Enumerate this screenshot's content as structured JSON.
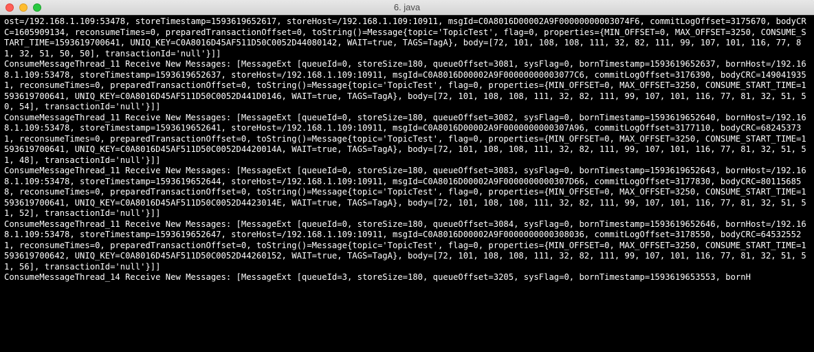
{
  "window": {
    "title": "6. java"
  },
  "log": {
    "lines": [
      "ost=/192.168.1.109:53478, storeTimestamp=1593619652617, storeHost=/192.168.1.109:10911, msgId=C0A8016D00002A9F00000000003074F6, commitLogOffset=3175670, bodyCRC=1605909134, reconsumeTimes=0, preparedTransactionOffset=0, toString()=Message{topic='TopicTest', flag=0, properties={MIN_OFFSET=0, MAX_OFFSET=3250, CONSUME_START_TIME=1593619700641, UNIQ_KEY=C0A8016D45AF511D50C0052D44080142, WAIT=true, TAGS=TagA}, body=[72, 101, 108, 108, 111, 32, 82, 111, 99, 107, 101, 116, 77, 81, 32, 51, 50, 50], transactionId='null'}]]",
      "ConsumeMessageThread_11 Receive New Messages: [MessageExt [queueId=0, storeSize=180, queueOffset=3081, sysFlag=0, bornTimestamp=1593619652637, bornHost=/192.168.1.109:53478, storeTimestamp=1593619652637, storeHost=/192.168.1.109:10911, msgId=C0A8016D00002A9F00000000003077C6, commitLogOffset=3176390, bodyCRC=1490419351, reconsumeTimes=0, preparedTransactionOffset=0, toString()=Message{topic='TopicTest', flag=0, properties={MIN_OFFSET=0, MAX_OFFSET=3250, CONSUME_START_TIME=1593619700641, UNIQ_KEY=C0A8016D45AF511D50C0052D441D0146, WAIT=true, TAGS=TagA}, body=[72, 101, 108, 108, 111, 32, 82, 111, 99, 107, 101, 116, 77, 81, 32, 51, 50, 54], transactionId='null'}]]",
      "ConsumeMessageThread_11 Receive New Messages: [MessageExt [queueId=0, storeSize=180, queueOffset=3082, sysFlag=0, bornTimestamp=1593619652640, bornHost=/192.168.1.109:53478, storeTimestamp=1593619652641, storeHost=/192.168.1.109:10911, msgId=C0A8016D00002A9F0000000000307A96, commitLogOffset=3177110, bodyCRC=682453731, reconsumeTimes=0, preparedTransactionOffset=0, toString()=Message{topic='TopicTest', flag=0, properties={MIN_OFFSET=0, MAX_OFFSET=3250, CONSUME_START_TIME=1593619700641, UNIQ_KEY=C0A8016D45AF511D50C0052D4420014A, WAIT=true, TAGS=TagA}, body=[72, 101, 108, 108, 111, 32, 82, 111, 99, 107, 101, 116, 77, 81, 32, 51, 51, 48], transactionId='null'}]]",
      "ConsumeMessageThread_11 Receive New Messages: [MessageExt [queueId=0, storeSize=180, queueOffset=3083, sysFlag=0, bornTimestamp=1593619652643, bornHost=/192.168.1.109:53478, storeTimestamp=1593619652644, storeHost=/192.168.1.109:10911, msgId=C0A8016D00002A9F0000000000307D66, commitLogOffset=3177830, bodyCRC=801156858, reconsumeTimes=0, preparedTransactionOffset=0, toString()=Message{topic='TopicTest', flag=0, properties={MIN_OFFSET=0, MAX_OFFSET=3250, CONSUME_START_TIME=1593619700641, UNIQ_KEY=C0A8016D45AF511D50C0052D4423014E, WAIT=true, TAGS=TagA}, body=[72, 101, 108, 108, 111, 32, 82, 111, 99, 107, 101, 116, 77, 81, 32, 51, 51, 52], transactionId='null'}]]",
      "ConsumeMessageThread_11 Receive New Messages: [MessageExt [queueId=0, storeSize=180, queueOffset=3084, sysFlag=0, bornTimestamp=1593619652646, bornHost=/192.168.1.109:53478, storeTimestamp=1593619652647, storeHost=/192.168.1.109:10911, msgId=C0A8016D00002A9F0000000000308036, commitLogOffset=3178550, bodyCRC=645325521, reconsumeTimes=0, preparedTransactionOffset=0, toString()=Message{topic='TopicTest', flag=0, properties={MIN_OFFSET=0, MAX_OFFSET=3250, CONSUME_START_TIME=1593619700642, UNIQ_KEY=C0A8016D45AF511D50C0052D44260152, WAIT=true, TAGS=TagA}, body=[72, 101, 108, 108, 111, 32, 82, 111, 99, 107, 101, 116, 77, 81, 32, 51, 51, 56], transactionId='null'}]]",
      "ConsumeMessageThread_14 Receive New Messages: [MessageExt [queueId=3, storeSize=180, queueOffset=3205, sysFlag=0, bornTimestamp=1593619653553, bornH"
    ]
  }
}
